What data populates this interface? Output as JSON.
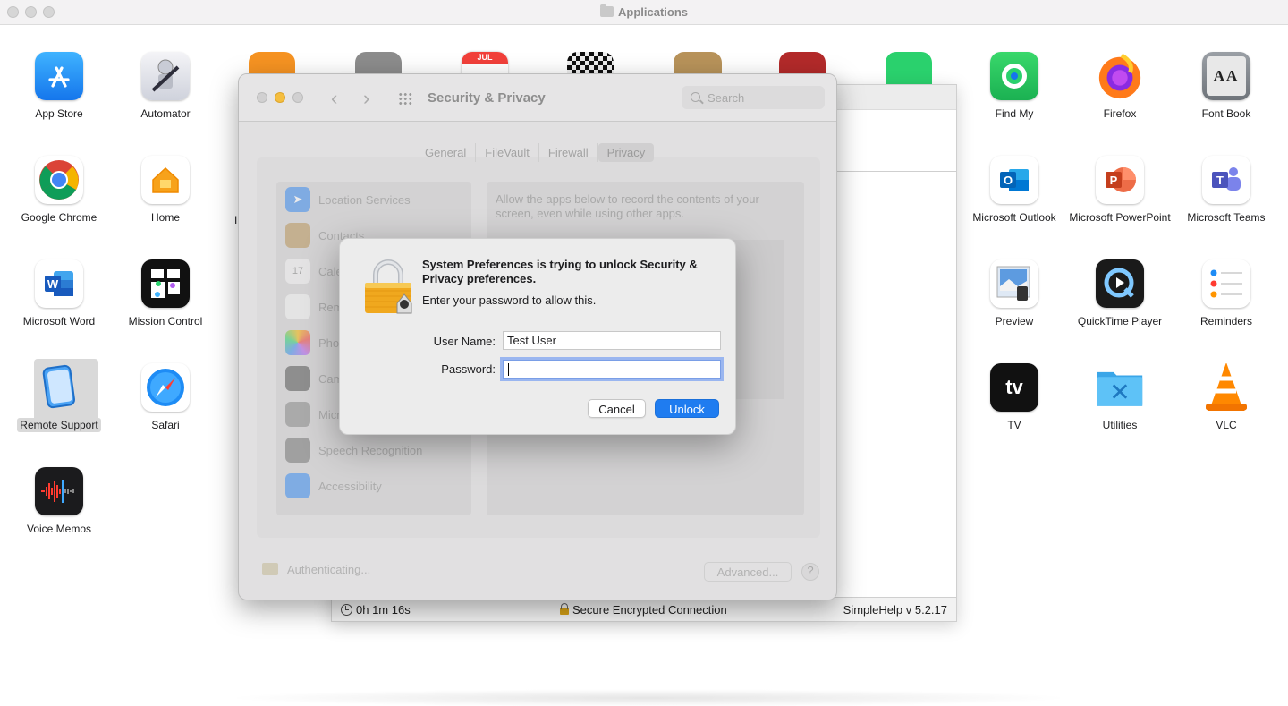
{
  "finder": {
    "title": "Applications",
    "apps": [
      {
        "name": "App Store",
        "icon": "app-store-icon"
      },
      {
        "name": "Automator",
        "icon": "automator-icon"
      },
      {
        "name": "Google Chrome",
        "icon": "chrome-icon"
      },
      {
        "name": "Home",
        "icon": "home-icon"
      },
      {
        "name": "Microsoft Word",
        "icon": "word-icon"
      },
      {
        "name": "Mission Control",
        "icon": "mission-control-icon"
      },
      {
        "name": "Remote Support",
        "icon": "remote-support-icon"
      },
      {
        "name": "Safari",
        "icon": "safari-icon"
      },
      {
        "name": "Voice Memos",
        "icon": "voice-memos-icon"
      },
      {
        "name": "Find My",
        "icon": "find-my-icon"
      },
      {
        "name": "Firefox",
        "icon": "firefox-icon"
      },
      {
        "name": "Font Book",
        "icon": "font-book-icon"
      },
      {
        "name": "Microsoft Outlook",
        "icon": "outlook-icon"
      },
      {
        "name": "Microsoft PowerPoint",
        "icon": "powerpoint-icon"
      },
      {
        "name": "Microsoft Teams",
        "icon": "teams-icon"
      },
      {
        "name": "Preview",
        "icon": "preview-icon"
      },
      {
        "name": "QuickTime Player",
        "icon": "quicktime-icon"
      },
      {
        "name": "Reminders",
        "icon": "reminders-icon"
      },
      {
        "name": "TV",
        "icon": "tv-icon"
      },
      {
        "name": "Utilities",
        "icon": "utilities-icon"
      },
      {
        "name": "VLC",
        "icon": "vlc-icon"
      }
    ],
    "partial_label": "I",
    "calendar_month": "JUL",
    "tv_text": "tv",
    "font_book_text": "AA"
  },
  "remote_session": {
    "timer": "0h 1m 16s",
    "connection": "Secure Encrypted Connection",
    "version": "SimpleHelp v 5.2.17"
  },
  "security_privacy": {
    "window_title": "Security & Privacy",
    "search_placeholder": "Search",
    "tabs": [
      "General",
      "FileVault",
      "Firewall",
      "Privacy"
    ],
    "active_tab": "Privacy",
    "sidebar": [
      "Location Services",
      "Contacts",
      "Calendars",
      "Reminders",
      "Photos",
      "Camera",
      "Microphone",
      "Speech Recognition",
      "Accessibility"
    ],
    "calendar_day": "17",
    "description": "Allow the apps below to record the contents of your screen, even while using other apps.",
    "status": "Authenticating...",
    "advanced_label": "Advanced...",
    "help_label": "?"
  },
  "auth_dialog": {
    "title": "System Preferences is trying to unlock Security & Privacy preferences.",
    "body": "Enter your password to allow this.",
    "username_label": "User Name:",
    "username_value": "Test User",
    "password_label": "Password:",
    "password_value": "",
    "cancel_label": "Cancel",
    "unlock_label": "Unlock"
  },
  "colors": {
    "accent": "#1f7cf0",
    "finder_bg": "#ffffff",
    "dimmed_window": "#e1e0e1"
  }
}
